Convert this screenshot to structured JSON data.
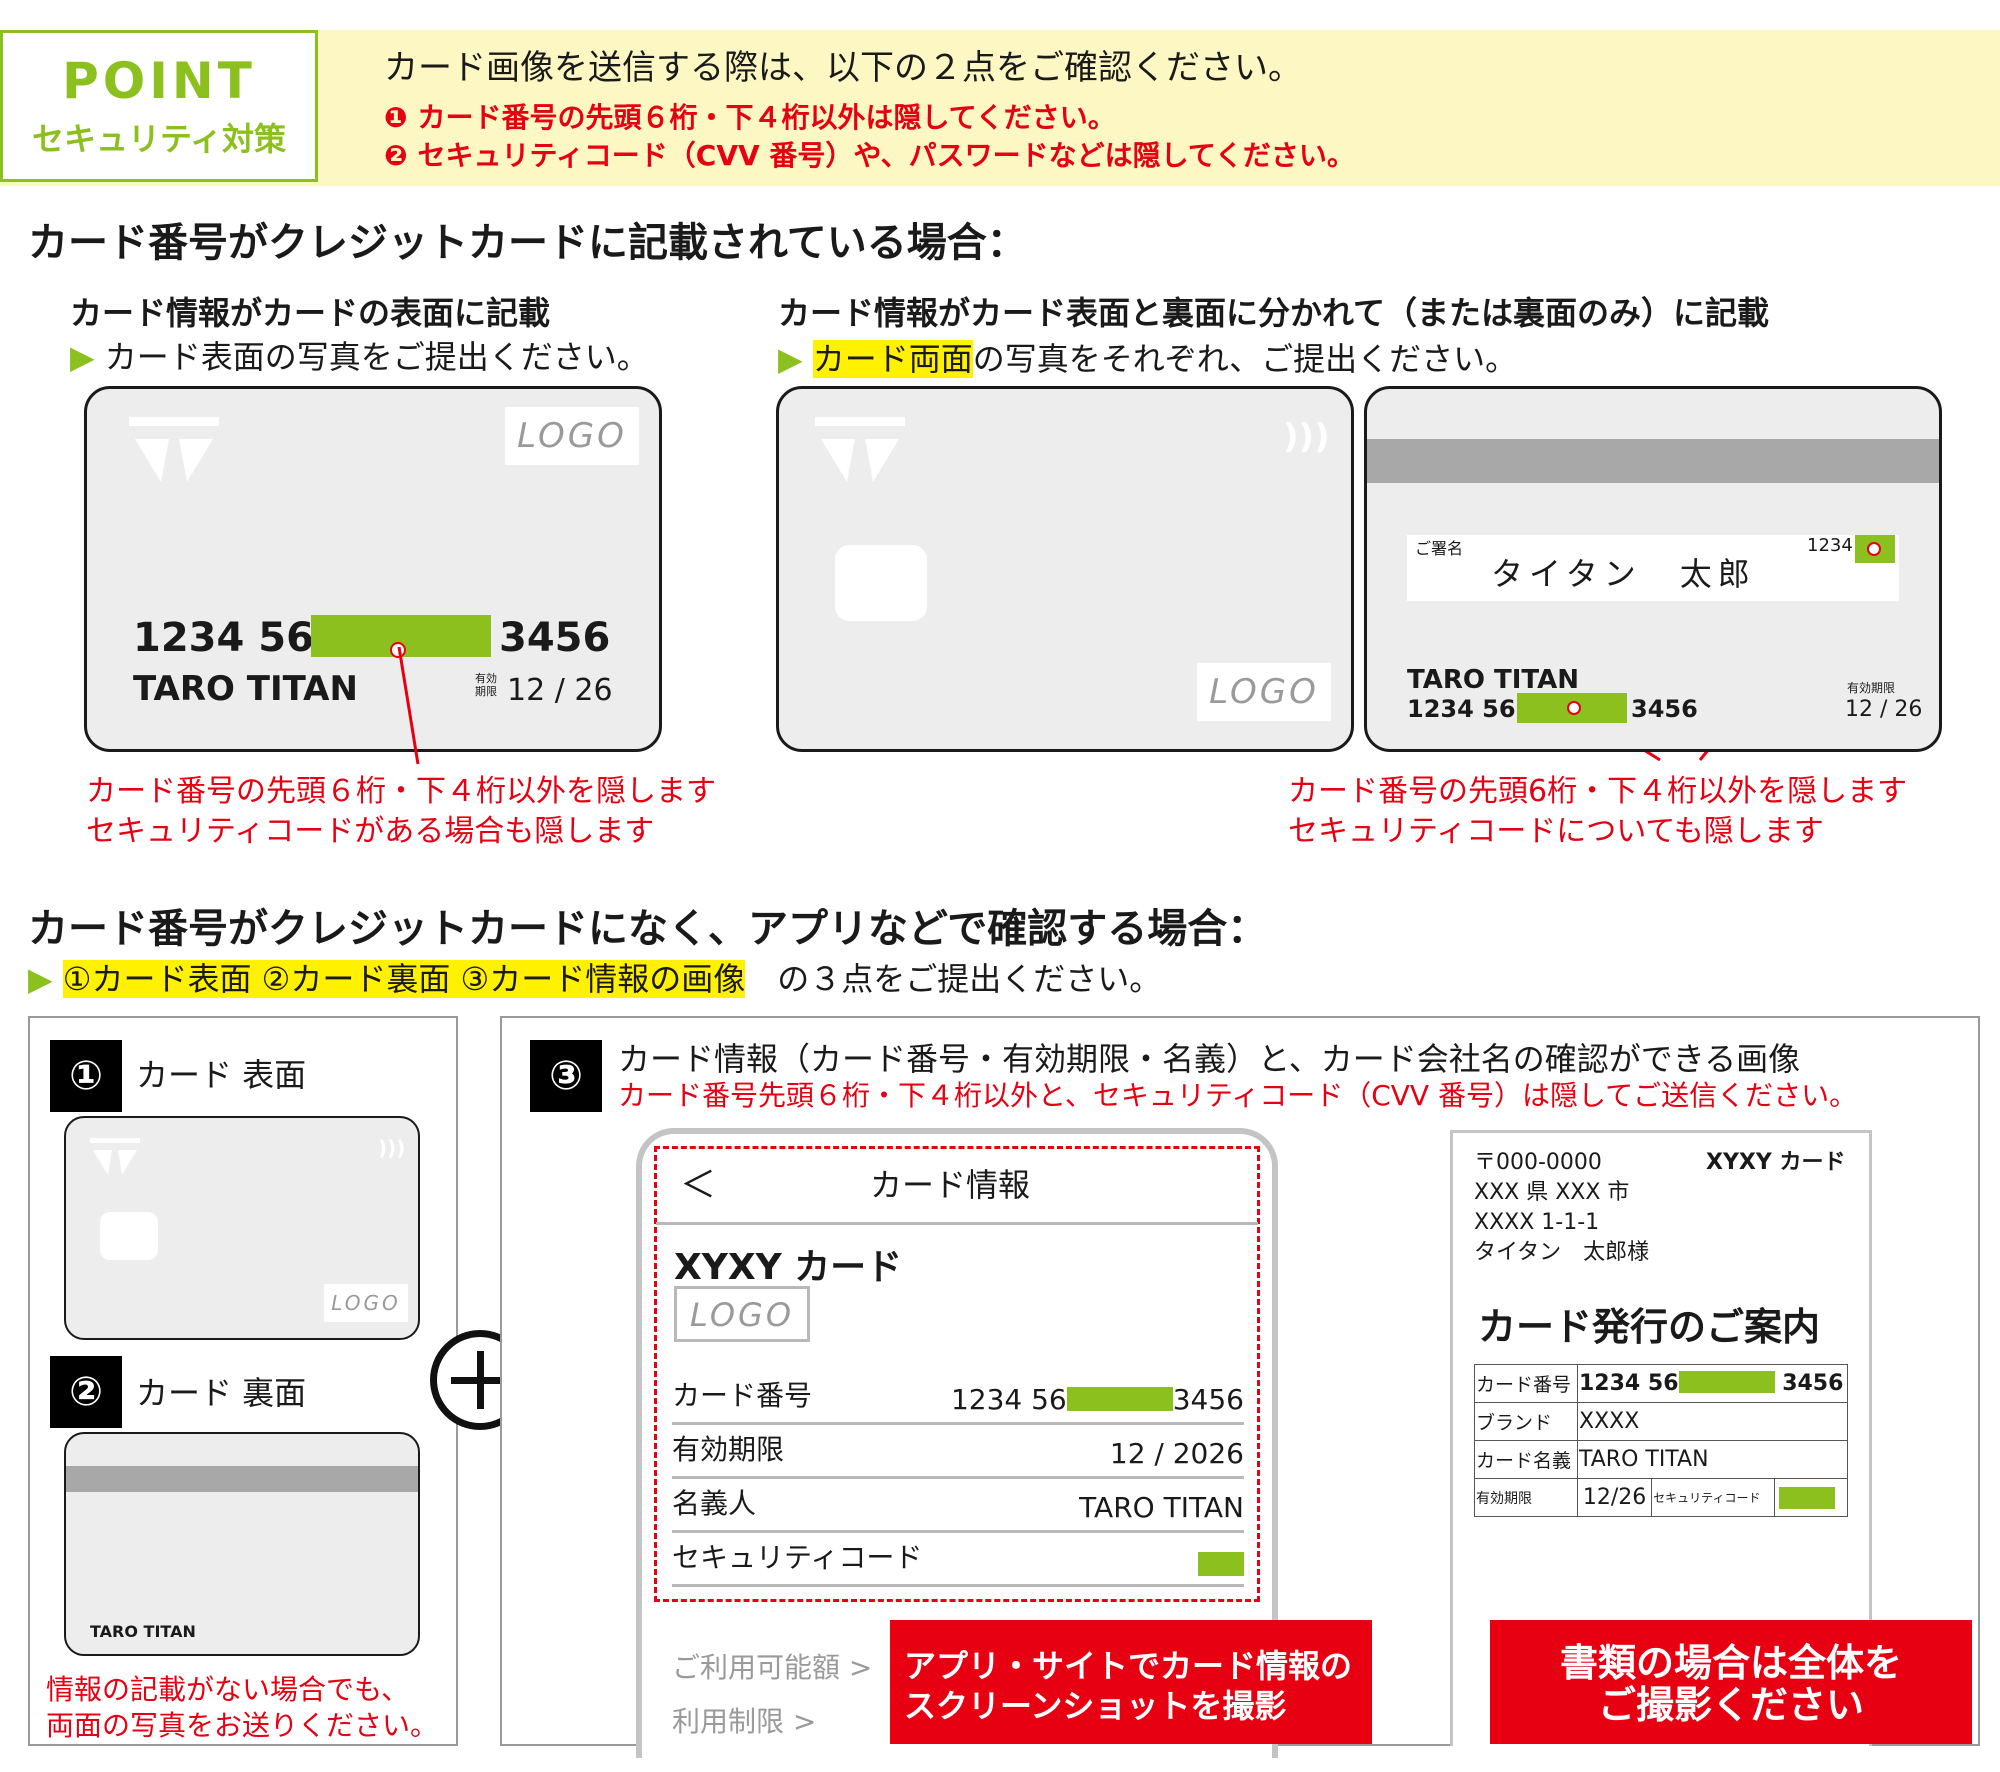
{
  "point": {
    "title": "POINT",
    "subtitle": "セキュリティ対策",
    "main": "カード画像を送信する際は、以下の２点をご確認ください。",
    "item1_num": "❶",
    "item1": "カード番号の先頭６桁・下４桁以外は隠してください。",
    "item2_num": "❷",
    "item2": "セキュリティコード（CVV 番号）や、パスワードなどは隠してください。"
  },
  "section1": {
    "title": "カード番号がクレジットカードに記載されている場合：",
    "left": {
      "title": "カード情報がカードの表面に記載",
      "sub": "カード表面の写真をご提出ください。",
      "card": {
        "logo": "LOGO",
        "num_left": "1234 56",
        "num_right": "3456",
        "name": "TARO TITAN",
        "exp_label": "有効\n期限",
        "exp": "12 / 26"
      },
      "note1": "カード番号の先頭６桁・下４桁以外を隠します",
      "note2": "セキュリティコードがある場合も隠します"
    },
    "right": {
      "title": "カード情報がカード表面と裏面に分かれて（または裏面のみ）に記載",
      "sub_hl": "カード両面",
      "sub_rest": "の写真をそれぞれ、ご提出ください。",
      "front": {
        "logo": "LOGO",
        "contactless": ")))"
      },
      "back": {
        "sig_label": "ご署名",
        "sig_name": "タイタン　太郎",
        "cvv_prefix": "1234",
        "name": "TARO TITAN",
        "num_left": "1234 56",
        "num_right": "3456",
        "exp_label": "有効期限",
        "exp": "12 / 26"
      },
      "note1": "カード番号の先頭6桁・下４桁以外を隠します",
      "note2": "セキュリティコードについても隠します"
    }
  },
  "section2": {
    "title": "カード番号がクレジットカードになく、アプリなどで確認する場合：",
    "sub_hl": "①カード表面 ②カード裏面 ③カード情報の画像",
    "sub_rest": "の３点をご提出ください。",
    "panel1": {
      "num1": "①",
      "label1": "カード 表面",
      "logo": "LOGO",
      "num2": "②",
      "label2": "カード 裏面",
      "back_name": "TARO TITAN",
      "note1": "情報の記載がない場合でも、",
      "note2": "両面の写真をお送りください。"
    },
    "plus": "⊕",
    "panel3": {
      "num": "③",
      "title": "カード情報（カード番号・有効期限・名義）と、カード会社名の確認ができる画像",
      "note": "カード番号先頭６桁・下４桁以外と、セキュリティコード（CVV 番号）は隠してご送信ください。",
      "app": {
        "back": "＜",
        "header": "カード情報",
        "card_name": "XYXY カード",
        "logo": "LOGO",
        "rows": [
          {
            "label": "カード番号",
            "value_left": "1234 56",
            "value_right": "3456"
          },
          {
            "label": "有効期限",
            "value": "12 / 2026"
          },
          {
            "label": "名義人",
            "value": "TARO TITAN"
          },
          {
            "label": "セキュリティコード"
          }
        ],
        "link1": "ご利用可能額 >",
        "link2": "利用制限 >",
        "red_label1": "アプリ・サイトでカード情報の",
        "red_label2": "スクリーンショットを撮影"
      },
      "doc": {
        "postal": "〒000-0000",
        "addr1": "XXX 県 XXX 市",
        "addr2": "XXXX 1-1-1",
        "addressee": "タイタン　太郎様",
        "company": "XYXY カード",
        "heading": "カード発行のご案内",
        "r1_label": "カード番号",
        "r1_left": "1234 56",
        "r1_right": "3456",
        "r2_label": "ブランド",
        "r2_value": "XXXX",
        "r3_label": "カード名義",
        "r3_value": "TARO TITAN",
        "r4_label": "有効期限",
        "r4_value": "12/26",
        "r4_label2": "セキュリティコード",
        "red_label1": "書類の場合は全体を",
        "red_label2": "ご撮影ください"
      }
    }
  },
  "colors": {
    "green": "#8cc01e",
    "red": "#e60012",
    "yellow": "#fff100",
    "banner": "#fcf7c3"
  }
}
